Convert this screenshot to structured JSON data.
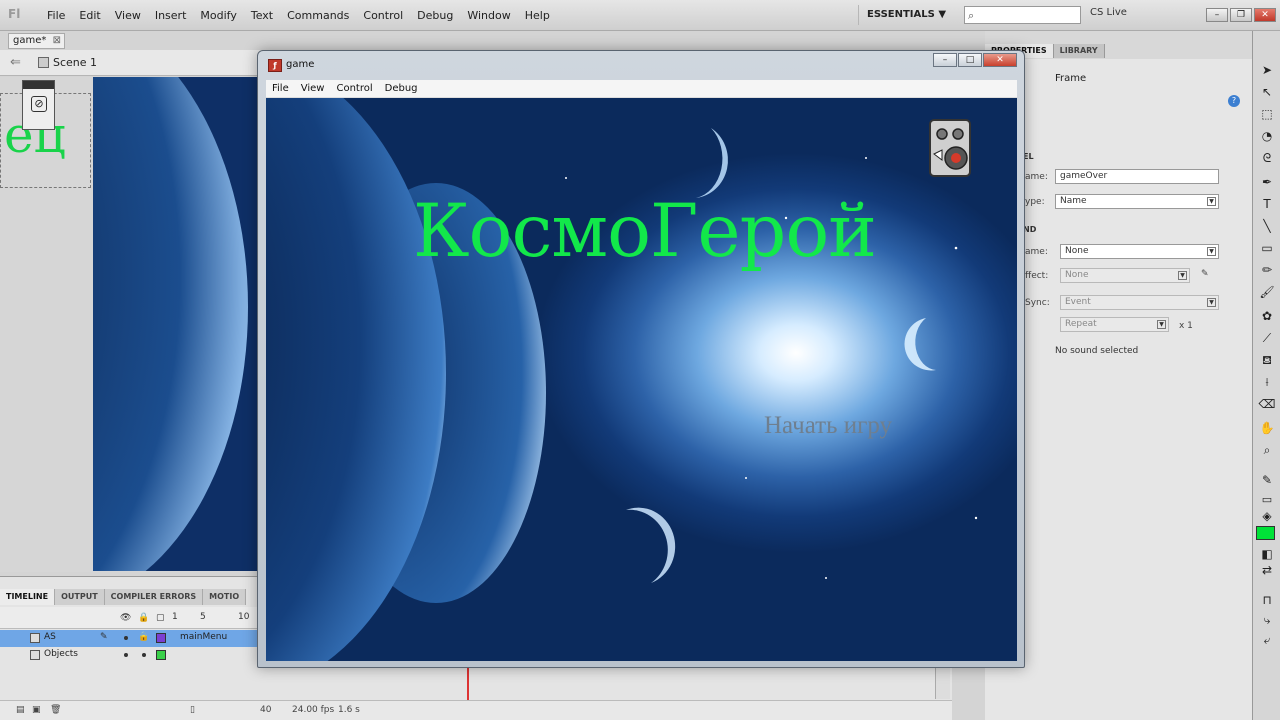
{
  "ide": {
    "logo": "Fl",
    "menu": [
      "File",
      "Edit",
      "View",
      "Insert",
      "Modify",
      "Text",
      "Commands",
      "Control",
      "Debug",
      "Window",
      "Help"
    ],
    "workspace": "ESSENTIALS ▼",
    "cs_live": "CS Live",
    "doc_tab": "game*",
    "scene": "Scene 1",
    "stage_text": "ец"
  },
  "timeline": {
    "tabs": [
      "TIMELINE",
      "OUTPUT",
      "COMPILER ERRORS",
      "MOTIO"
    ],
    "frame_numbers": [
      "1",
      "5",
      "10"
    ],
    "layers": [
      {
        "name": "AS",
        "frame_label": "mainMenu"
      },
      {
        "name": "Objects",
        "frame_label": ""
      }
    ],
    "fps": "24.00 fps",
    "time": "1.6 s",
    "frame": "40"
  },
  "properties": {
    "tabs": [
      "PROPERTIES",
      "LIBRARY"
    ],
    "type_label": "Frame",
    "label_section": "EL",
    "name_label": "ame:",
    "name_value": "gameOver",
    "type_field_label": "ype:",
    "type_value": "Name",
    "sound_section": "ND",
    "sound_name_label": "ame:",
    "sound_name_value": "None",
    "effect_label": "ffect:",
    "effect_value": "None",
    "sync_label": "Sync:",
    "sync_value": "Event",
    "repeat_value": "Repeat",
    "repeat_count": "x 1",
    "no_sound": "No sound selected"
  },
  "colors": {
    "fill": "#00e238",
    "title_green": "#12e84a"
  },
  "game_window": {
    "title": "game",
    "menu": [
      "File",
      "View",
      "Control",
      "Debug"
    ],
    "game_title": "КосмоГерой",
    "start_button": "Начать игру",
    "sound_icon": "speaker-icon"
  }
}
